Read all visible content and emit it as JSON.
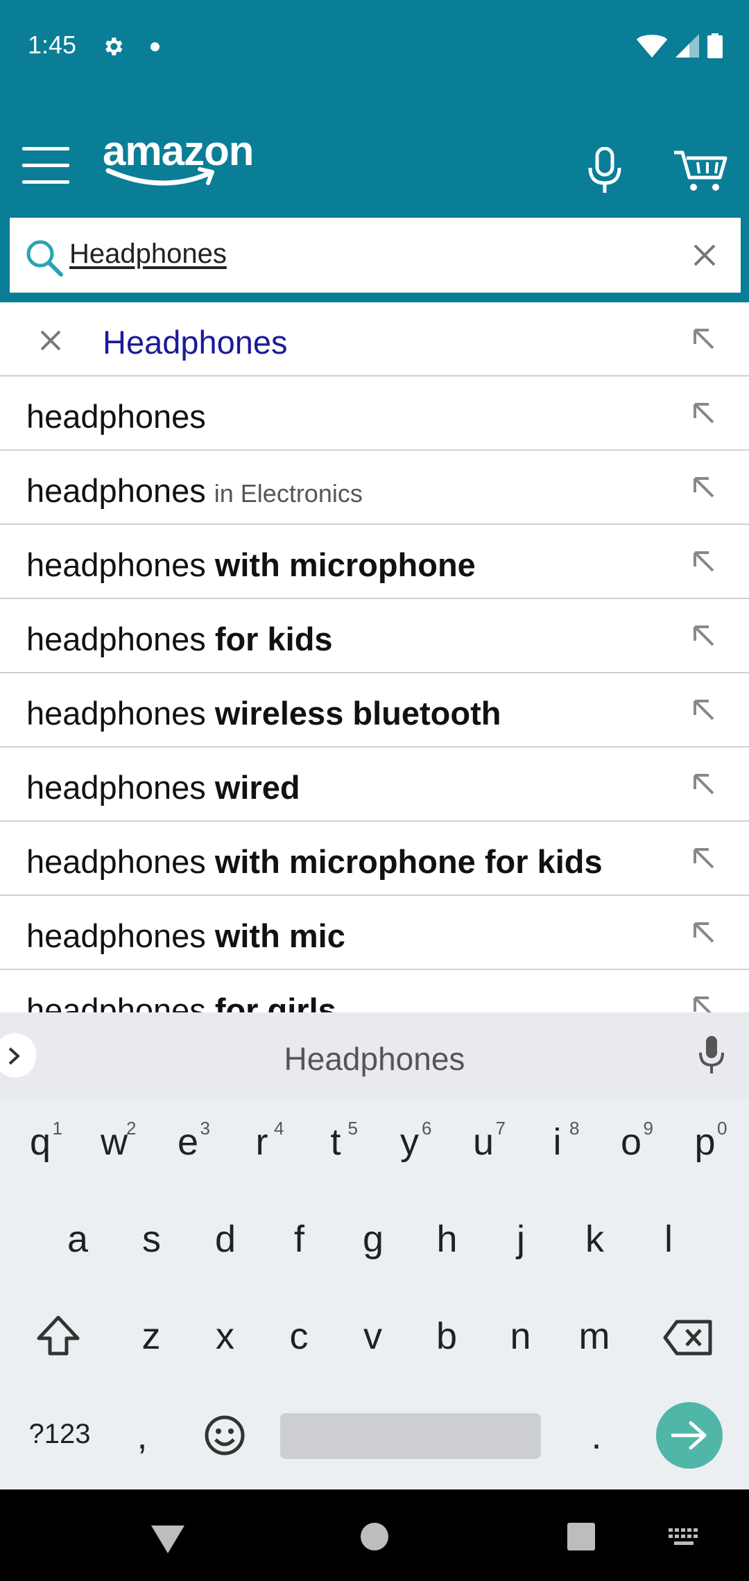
{
  "status_bar": {
    "time": "1:45",
    "icons": [
      "gear-icon",
      "notification-dot",
      "wifi-icon",
      "signal-icon",
      "battery-icon"
    ]
  },
  "header": {
    "logo_text": "amazon",
    "icons": [
      "menu-icon",
      "mic-icon",
      "cart-icon"
    ],
    "brand_color": "#0a7e97"
  },
  "search": {
    "value": "Headphones",
    "icons": [
      "search-icon",
      "clear-icon"
    ]
  },
  "suggestions": [
    {
      "base": "Headphones",
      "bold": "",
      "dept": ""
    },
    {
      "base": "headphones",
      "bold": "",
      "dept": ""
    },
    {
      "base": "headphones",
      "bold": "",
      "dept": "in Electronics"
    },
    {
      "base": "headphones ",
      "bold": "with microphone",
      "dept": ""
    },
    {
      "base": "headphones ",
      "bold": "for kids",
      "dept": ""
    },
    {
      "base": "headphones ",
      "bold": "wireless bluetooth",
      "dept": ""
    },
    {
      "base": "headphones ",
      "bold": "wired",
      "dept": ""
    },
    {
      "base": "headphones ",
      "bold": "with microphone for kids",
      "dept": ""
    },
    {
      "base": "headphones ",
      "bold": "with mic",
      "dept": ""
    },
    {
      "base": "headphones ",
      "bold": "for girls",
      "dept": ""
    }
  ],
  "keyboard": {
    "suggestion": "Headphones",
    "row1": [
      {
        "key": "q",
        "hint": "1"
      },
      {
        "key": "w",
        "hint": "2"
      },
      {
        "key": "e",
        "hint": "3"
      },
      {
        "key": "r",
        "hint": "4"
      },
      {
        "key": "t",
        "hint": "5"
      },
      {
        "key": "y",
        "hint": "6"
      },
      {
        "key": "u",
        "hint": "7"
      },
      {
        "key": "i",
        "hint": "8"
      },
      {
        "key": "o",
        "hint": "9"
      },
      {
        "key": "p",
        "hint": "0"
      }
    ],
    "row2": [
      "a",
      "s",
      "d",
      "f",
      "g",
      "h",
      "j",
      "k",
      "l"
    ],
    "row3": [
      "z",
      "x",
      "c",
      "v",
      "b",
      "n",
      "m"
    ],
    "symbols_label": "?123",
    "comma": ",",
    "period": ".",
    "accent_color": "#4fb6a8"
  },
  "nav_bar": {
    "icons": [
      "back-icon",
      "home-icon",
      "recents-icon",
      "keyboard-switch-icon"
    ]
  }
}
